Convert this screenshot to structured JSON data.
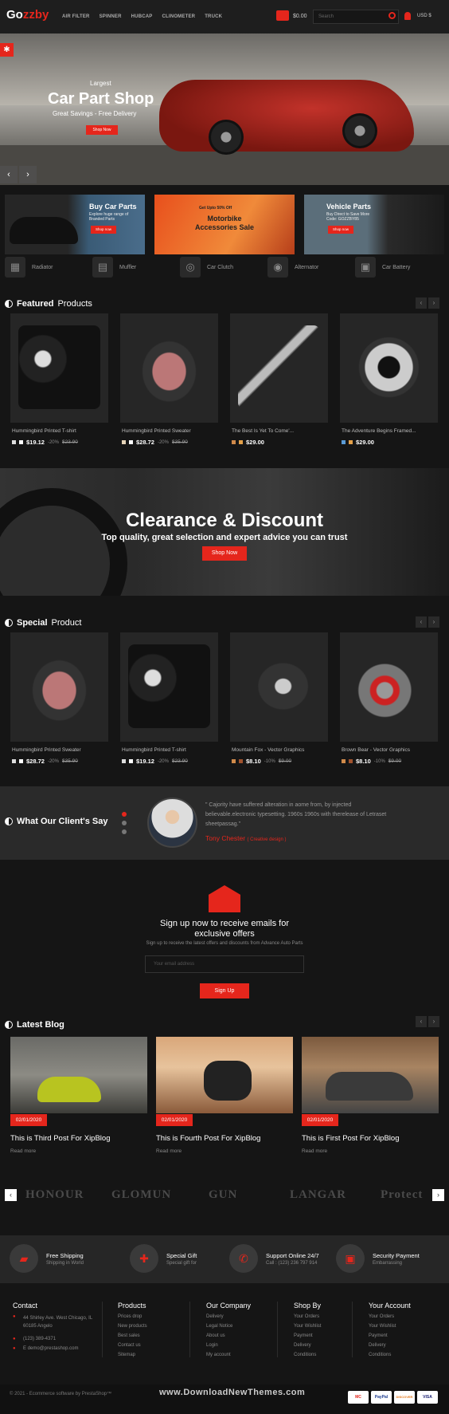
{
  "header": {
    "logo_prefix": "Go",
    "logo_suffix": "zzby",
    "nav": [
      "AIR FILTER",
      "SPINNER",
      "HUBCAP",
      "CLINOMETER",
      "TRUCK"
    ],
    "cart_amount": "$0.00",
    "search_placeholder": "Search",
    "currency": "USD $"
  },
  "hero": {
    "sub": "Largest",
    "title": "Car Part Shop",
    "tag": "Great Savings - Free Delivery",
    "button": "Shop Now"
  },
  "banners": [
    {
      "title": "Buy Car Parts",
      "sub": "Explore huge range of Branded Parts",
      "button": "Shop now"
    },
    {
      "title": "Motorbike Accessories Sale",
      "sub": "Get Upto 50% Off"
    },
    {
      "title": "Vehicle Parts",
      "sub": "Buy Direct to Save More Code: GOZZBY85",
      "button": "Shop now"
    }
  ],
  "categories": [
    "Radiator",
    "Muffler",
    "Car Clutch",
    "Alternator",
    "Car Battery"
  ],
  "featured": {
    "title_bold": "Featured",
    "title_light": "Products",
    "products": [
      {
        "name": "Hummingbird Printed T-shirt",
        "price": "$19.12",
        "discount": "-20%",
        "old": "$23.90"
      },
      {
        "name": "Hummingbird Printed Sweater",
        "price": "$28.72",
        "discount": "-20%",
        "old": "$35.90"
      },
      {
        "name": "The Best Is Yet To Come'...",
        "price": "$29.00",
        "discount": "",
        "old": ""
      },
      {
        "name": "The Adventure Begins Framed...",
        "price": "$29.00",
        "discount": "",
        "old": ""
      }
    ]
  },
  "clearance": {
    "title": "Clearance & Discount",
    "sub": "Top quality, great selection and expert advice you can trust",
    "button": "Shop Now"
  },
  "special": {
    "title_bold": "Special",
    "title_light": "Product",
    "products": [
      {
        "name": "Hummingbird Printed Sweater",
        "price": "$28.72",
        "discount": "-20%",
        "old": "$35.90"
      },
      {
        "name": "Hummingbird Printed T-shirt",
        "price": "$19.12",
        "discount": "-20%",
        "old": "$23.90"
      },
      {
        "name": "Mountain Fox - Vector Graphics",
        "price": "$8.10",
        "discount": "-10%",
        "old": "$9.00"
      },
      {
        "name": "Brown Bear - Vector Graphics",
        "price": "$8.10",
        "discount": "-10%",
        "old": "$9.00"
      }
    ]
  },
  "testimonial": {
    "heading": "What Our Client's Say",
    "quote": "\" Cajority have suffered alteration in aome from, by injected believable.electronic typesetting. 1960s 1960s with therelease of Letraset sheetpassag.\"",
    "name": "Tony Chester",
    "role": "( Creative design )"
  },
  "newsletter": {
    "title": "Sign up now to receive emails for exclusive offers",
    "sub": "Sign up to receive the latest offers and discounts from Advance Auto Parts",
    "placeholder": "Your email address",
    "button": "Sign Up"
  },
  "blog": {
    "heading": "Latest Blog",
    "posts": [
      {
        "date": "02/01/2020",
        "title": "This is Third Post For XipBlog",
        "more": "Read more"
      },
      {
        "date": "02/01/2020",
        "title": "This is Fourth Post For XipBlog",
        "more": "Read more"
      },
      {
        "date": "02/01/2020",
        "title": "This is First Post For XipBlog",
        "more": "Read more"
      }
    ]
  },
  "brands": [
    "HONOUR",
    "GLOMUN",
    "GUN",
    "LANGAR",
    "Protect"
  ],
  "services": [
    {
      "title": "Free Shipping",
      "sub": "Shipping in World"
    },
    {
      "title": "Special Gift",
      "sub": "Special gift for"
    },
    {
      "title": "Support Online 24/7",
      "sub": "Call : (123) 236 797 914"
    },
    {
      "title": "Security Payment",
      "sub": "Embarrassing"
    }
  ],
  "footer": {
    "contact": {
      "title": "Contact",
      "address": "44 Shirley Ave. West Chicago, IL 60185 Angelo",
      "phone": "(123) 389-4371",
      "email": "E demo@prestashop.com"
    },
    "products": {
      "title": "Products",
      "links": [
        "Prices drop",
        "New products",
        "Best sales",
        "Contact us",
        "Sitemap"
      ]
    },
    "company": {
      "title": "Our Company",
      "links": [
        "Delivery",
        "Legal Notice",
        "About us",
        "Login",
        "My account"
      ]
    },
    "shopby": {
      "title": "Shop By",
      "links": [
        "Your Orders",
        "Your Wishlist",
        "Payment",
        "Delivery",
        "Conditions"
      ]
    },
    "account": {
      "title": "Your Account",
      "links": [
        "Your Orders",
        "Your Wishlist",
        "Payment",
        "Delivery",
        "Conditions"
      ]
    },
    "copyright": "© 2021 - Ecommerce software by PrestaShop™",
    "watermark": "www.DownloadNewThemes.com",
    "payments": [
      "MC",
      "PayPal",
      "DISCOVER",
      "VISA"
    ]
  }
}
